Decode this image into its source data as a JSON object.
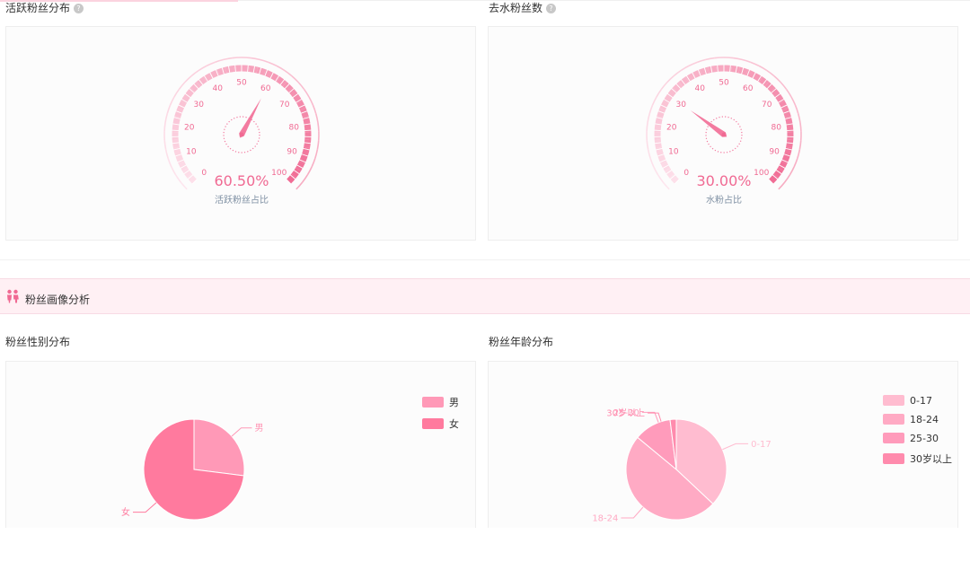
{
  "sections": {
    "active": {
      "title": "活跃粉丝分布"
    },
    "water": {
      "title": "去水粉丝数"
    },
    "profile": {
      "title": "粉丝画像分析"
    },
    "gender": {
      "title": "粉丝性别分布"
    },
    "age": {
      "title": "粉丝年龄分布"
    }
  },
  "icons": {
    "help": "help-circle-icon",
    "band": "people-icon"
  },
  "colors": {
    "accent": "#f06a93",
    "tick": "#f37ba0",
    "gender_male": "#ff99b7",
    "gender_female": "#ff7a9e",
    "age_0_17": "#ffbcd0",
    "age_18_24": "#ffaac4",
    "age_25_30": "#ff9bbb",
    "age_30_plus": "#ff8bad"
  },
  "chart_data": [
    {
      "type": "gauge",
      "value": 60.5,
      "value_label": "60.50%",
      "label": "活跃粉丝占比",
      "min": 0,
      "max": 100,
      "ticks": [
        "0",
        "10",
        "20",
        "30",
        "40",
        "50",
        "60",
        "70",
        "80",
        "90",
        "100"
      ]
    },
    {
      "type": "gauge",
      "value": 30.0,
      "value_label": "30.00%",
      "label": "水粉占比",
      "min": 0,
      "max": 100,
      "ticks": [
        "0",
        "10",
        "20",
        "30",
        "40",
        "50",
        "60",
        "70",
        "80",
        "90",
        "100"
      ]
    },
    {
      "type": "pie",
      "categories": [
        "男",
        "女"
      ],
      "values": [
        27,
        73
      ],
      "legend": [
        "男",
        "女"
      ],
      "legend_position": "top-right"
    },
    {
      "type": "pie",
      "categories": [
        "0-17",
        "18-24",
        "25-30",
        "30岁以上"
      ],
      "values": [
        37,
        49,
        12,
        2
      ],
      "legend": [
        "0-17",
        "18-24",
        "25-30",
        "30岁以上"
      ],
      "legend_position": "top-right"
    }
  ]
}
